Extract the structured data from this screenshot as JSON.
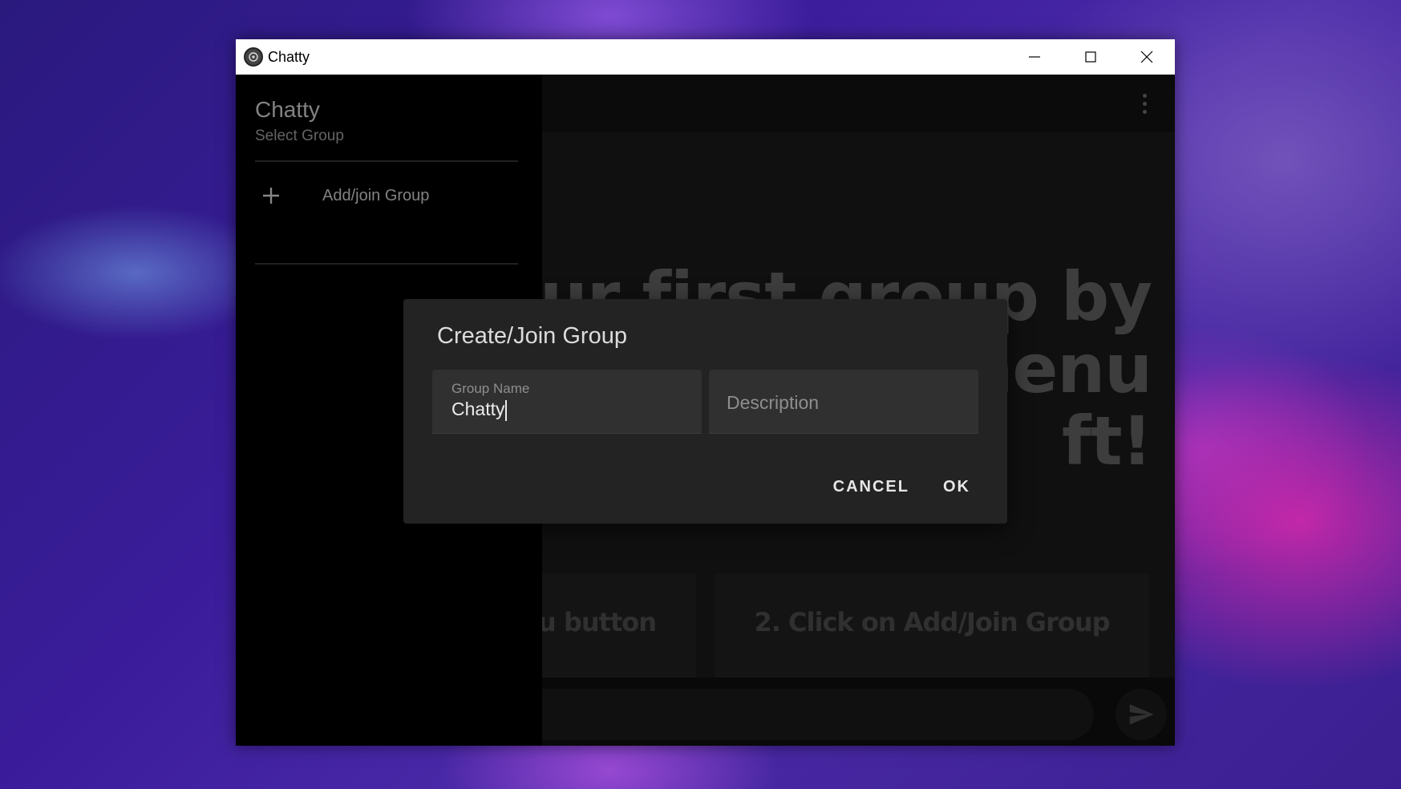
{
  "window": {
    "title": "Chatty",
    "controls": [
      "minimize-icon",
      "maximize-icon",
      "close-icon"
    ]
  },
  "sidebar": {
    "title": "Chatty",
    "subtitle": "Select Group",
    "items": [
      {
        "label": "Add/join Group",
        "icon": "plus-icon"
      }
    ]
  },
  "main": {
    "hint": "our first group by\nng on the menu\nft!",
    "cards": [
      {
        "label": "u button"
      },
      {
        "label": "2. Click on Add/Join Group",
        "icon": "plus-icon"
      }
    ],
    "send_icon": "send-icon",
    "menu_icon": "more-vert-icon"
  },
  "dialog": {
    "title": "Create/Join Group",
    "group_name": {
      "label": "Group Name",
      "value": "Chatty"
    },
    "description": {
      "placeholder": "Description"
    },
    "cancel_label": "CANCEL",
    "ok_label": "OK"
  }
}
